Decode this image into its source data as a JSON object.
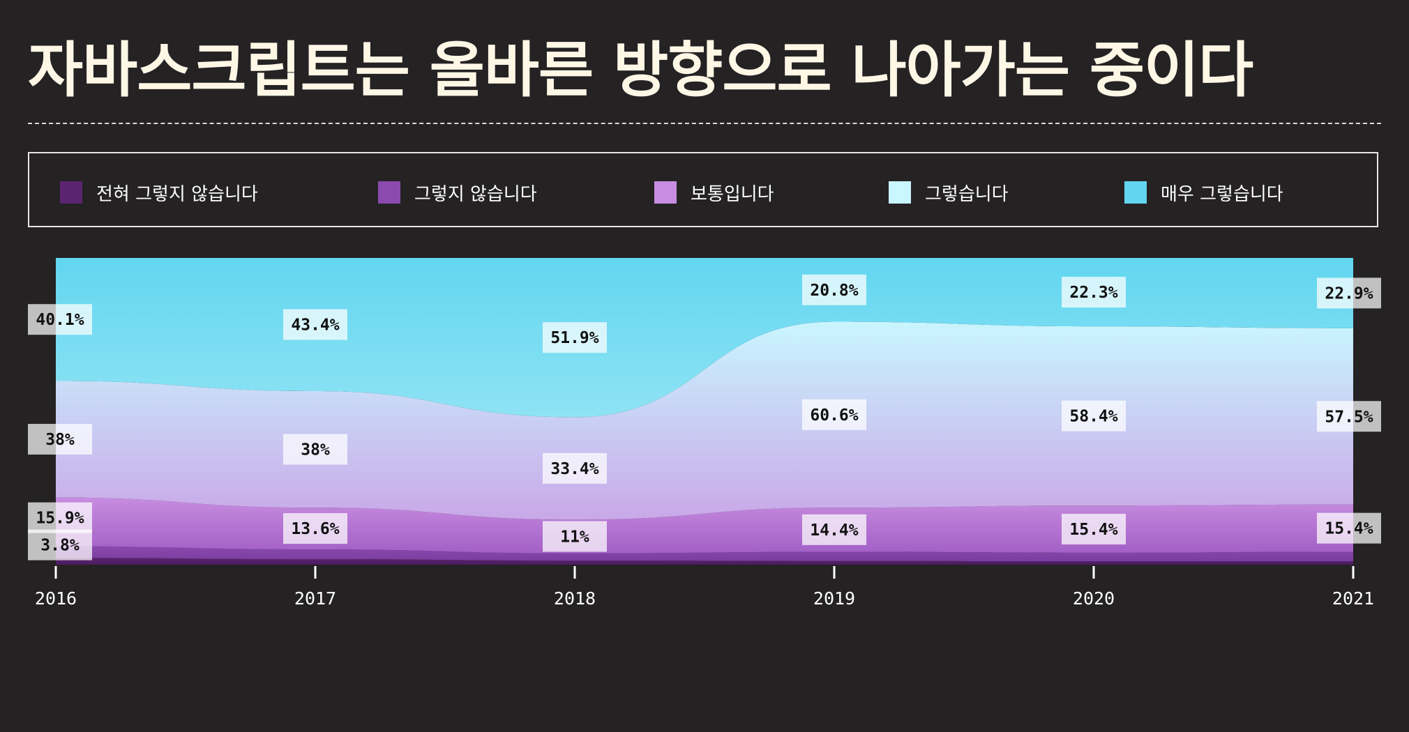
{
  "title": "자바스크립트는 올바른 방향으로 나아가는 중이다",
  "colors": {
    "background": "#252224",
    "strongly_disagree": "#5a2470",
    "disagree": "#8a4aae",
    "neutral": "#c78de0",
    "agree": "#c9f6ff",
    "strongly_agree": "#62d6f0"
  },
  "legend": [
    {
      "key": "strongly_disagree",
      "label": "전혀 그렇지 않습니다"
    },
    {
      "key": "disagree",
      "label": "그렇지 않습니다"
    },
    {
      "key": "neutral",
      "label": "보통입니다"
    },
    {
      "key": "agree",
      "label": "그렇습니다"
    },
    {
      "key": "strongly_agree",
      "label": "매우 그렇습니다"
    }
  ],
  "chart_data": {
    "type": "area",
    "stacked": true,
    "normalized": true,
    "x": [
      "2016",
      "2017",
      "2018",
      "2019",
      "2020",
      "2021"
    ],
    "series": [
      {
        "name": "전혀 그렇지 않습니다",
        "key": "strongly_disagree",
        "values": [
          2.2,
          1.8,
          1.3,
          1.2,
          1.1,
          1.1
        ]
      },
      {
        "name": "그렇지 않습니다",
        "key": "disagree",
        "values": [
          3.8,
          3.2,
          2.4,
          3.0,
          2.8,
          3.1
        ]
      },
      {
        "name": "보통입니다",
        "key": "neutral",
        "values": [
          15.9,
          13.6,
          11,
          14.4,
          15.4,
          15.4
        ]
      },
      {
        "name": "그렇습니다",
        "key": "agree",
        "values": [
          38,
          38,
          33.4,
          60.6,
          58.4,
          57.5
        ]
      },
      {
        "name": "매우 그렇습니다",
        "key": "strongly_agree",
        "values": [
          40.1,
          43.4,
          51.9,
          20.8,
          22.3,
          22.9
        ]
      }
    ],
    "labels": {
      "disagree": [
        "3.8%",
        "",
        "",
        "",
        "",
        ""
      ],
      "neutral": [
        "15.9%",
        "13.6%",
        "11%",
        "14.4%",
        "15.4%",
        "15.4%"
      ],
      "agree": [
        "38%",
        "38%",
        "33.4%",
        "60.6%",
        "58.4%",
        "57.5%"
      ],
      "strongly_agree": [
        "40.1%",
        "43.4%",
        "51.9%",
        "20.8%",
        "22.3%",
        "22.9%"
      ]
    },
    "ylim": [
      0,
      100
    ],
    "grid": false,
    "legend_position": "top"
  }
}
